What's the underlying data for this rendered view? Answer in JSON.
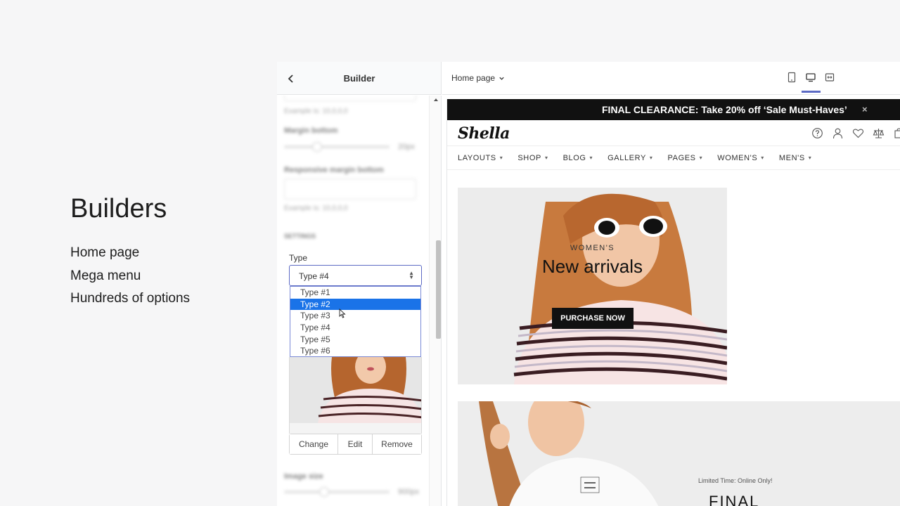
{
  "feature": {
    "title": "Builders",
    "items": [
      "Home page",
      "Mega menu",
      "Hundreds of options"
    ]
  },
  "sidebar": {
    "title": "Builder",
    "type_label": "Type",
    "type_value": "Type #4",
    "type_options": [
      "Type #1",
      "Type #2",
      "Type #3",
      "Type #4",
      "Type #5",
      "Type #6"
    ],
    "highlighted_option": "Type #2",
    "image_actions": {
      "change": "Change",
      "edit": "Edit",
      "remove": "Remove"
    }
  },
  "topbar": {
    "page_select": "Home page",
    "devices": [
      "tablet-icon",
      "desktop-icon",
      "fullwidth-icon"
    ],
    "active_device": "desktop-icon"
  },
  "preview": {
    "announcement": "FINAL CLEARANCE: Take 20% off ‘Sale Must-Haves’",
    "close": "×",
    "logo": "Shella",
    "nav": [
      "LAYOUTS",
      "SHOP",
      "BLOG",
      "GALLERY",
      "PAGES",
      "WOMEN'S",
      "MEN'S"
    ],
    "hero": {
      "eyebrow": "WOMEN'S",
      "title": "New arrivals",
      "button": "PURCHASE NOW"
    },
    "banner2": {
      "limited": "Limited Time: Online Only!",
      "title": "FINAL"
    }
  },
  "colors": {
    "accent": "#5c6ac4",
    "highlight": "#1a73e8",
    "announce_bg": "#111111"
  }
}
